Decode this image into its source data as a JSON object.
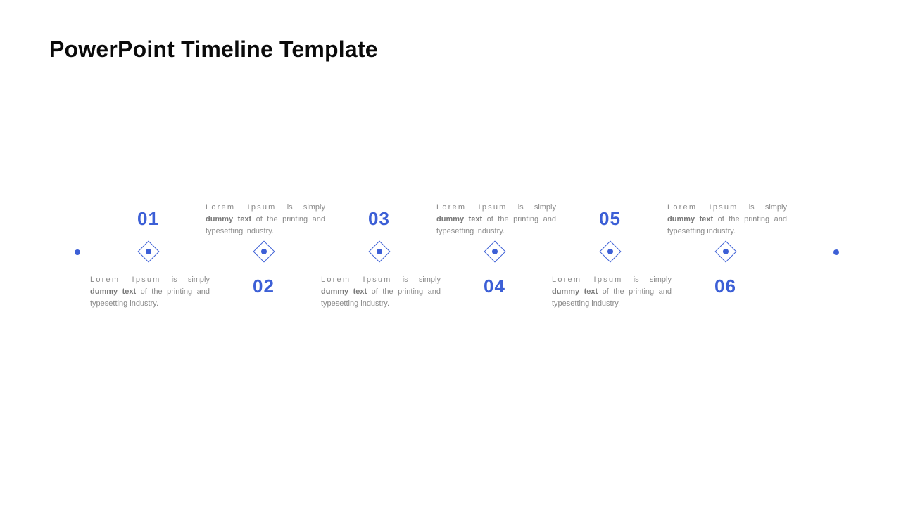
{
  "title": "PowerPoint Timeline Template",
  "accent": "#3c5fd6",
  "items": [
    {
      "num": "01",
      "lead": "Lorem Ipsum",
      "rest1": " is simply ",
      "bold": "dummy text",
      "rest2": " of the printing and typesetting industry."
    },
    {
      "num": "02",
      "lead": "Lorem Ipsum",
      "rest1": " is simply ",
      "bold": "dummy text",
      "rest2": " of the printing and typesetting industry."
    },
    {
      "num": "03",
      "lead": "Lorem Ipsum",
      "rest1": " is simply ",
      "bold": "dummy text",
      "rest2": " of the printing and typesetting industry."
    },
    {
      "num": "04",
      "lead": "Lorem Ipsum",
      "rest1": " is simply ",
      "bold": "dummy text",
      "rest2": " of the printing and typesetting industry."
    },
    {
      "num": "05",
      "lead": "Lorem Ipsum",
      "rest1": " is simply ",
      "bold": "dummy text",
      "rest2": " of the printing and typesetting industry."
    },
    {
      "num": "06",
      "lead": "Lorem Ipsum",
      "rest1": " is simply ",
      "bold": "dummy text",
      "rest2": " of the printing and typesetting industry."
    }
  ]
}
